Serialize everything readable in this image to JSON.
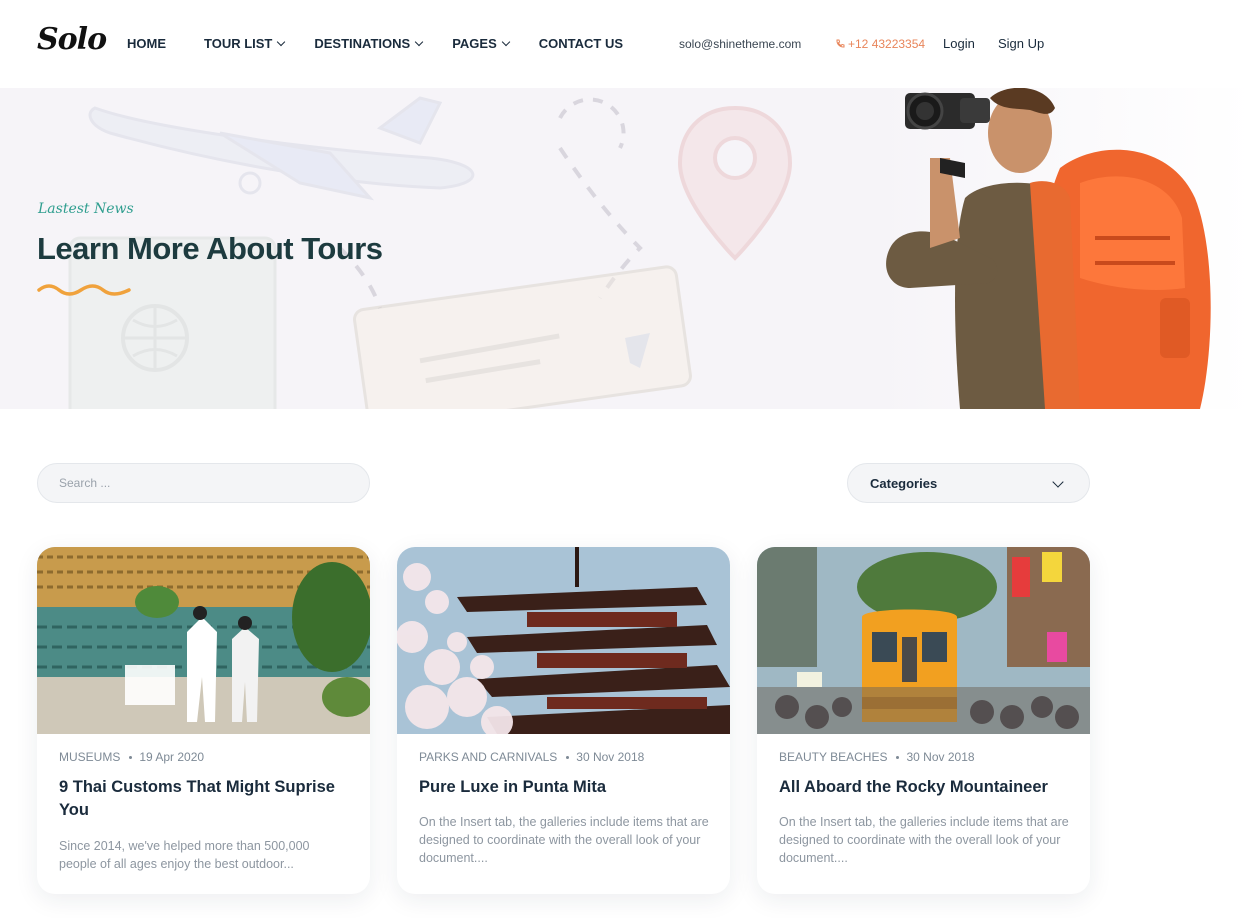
{
  "header": {
    "logo": "Solo",
    "nav": [
      {
        "label": "HOME",
        "dropdown": false
      },
      {
        "label": "TOUR LIST",
        "dropdown": true
      },
      {
        "label": "DESTINATIONS",
        "dropdown": true
      },
      {
        "label": "PAGES",
        "dropdown": true
      },
      {
        "label": "CONTACT US",
        "dropdown": false
      }
    ],
    "email": "solo@shinetheme.com",
    "phone": "+12 43223354",
    "login": "Login",
    "signup": "Sign Up",
    "phone_color": "#e8855a"
  },
  "hero": {
    "subtitle": "Lastest News",
    "title": "Learn More About Tours",
    "accent_color": "#f0a23c"
  },
  "filters": {
    "search_placeholder": "Search ...",
    "categories_label": "Categories"
  },
  "posts": [
    {
      "category": "MUSEUMS",
      "date": "19 Apr 2020",
      "title": "9 Thai Customs That Might Suprise You",
      "excerpt": "Since 2014, we've helped more than 500,000 people of all ages enjoy the best outdoor..."
    },
    {
      "category": "PARKS AND CARNIVALS",
      "date": "30 Nov 2018",
      "title": "Pure Luxe in Punta Mita",
      "excerpt": "On the Insert tab, the galleries include items that are designed to coordinate with the overall look of your document...."
    },
    {
      "category": "BEAUTY BEACHES",
      "date": "30 Nov 2018",
      "title": "All Aboard the Rocky Mountaineer",
      "excerpt": "On the Insert tab, the galleries include items that are designed to coordinate with the overall look of your document...."
    }
  ]
}
